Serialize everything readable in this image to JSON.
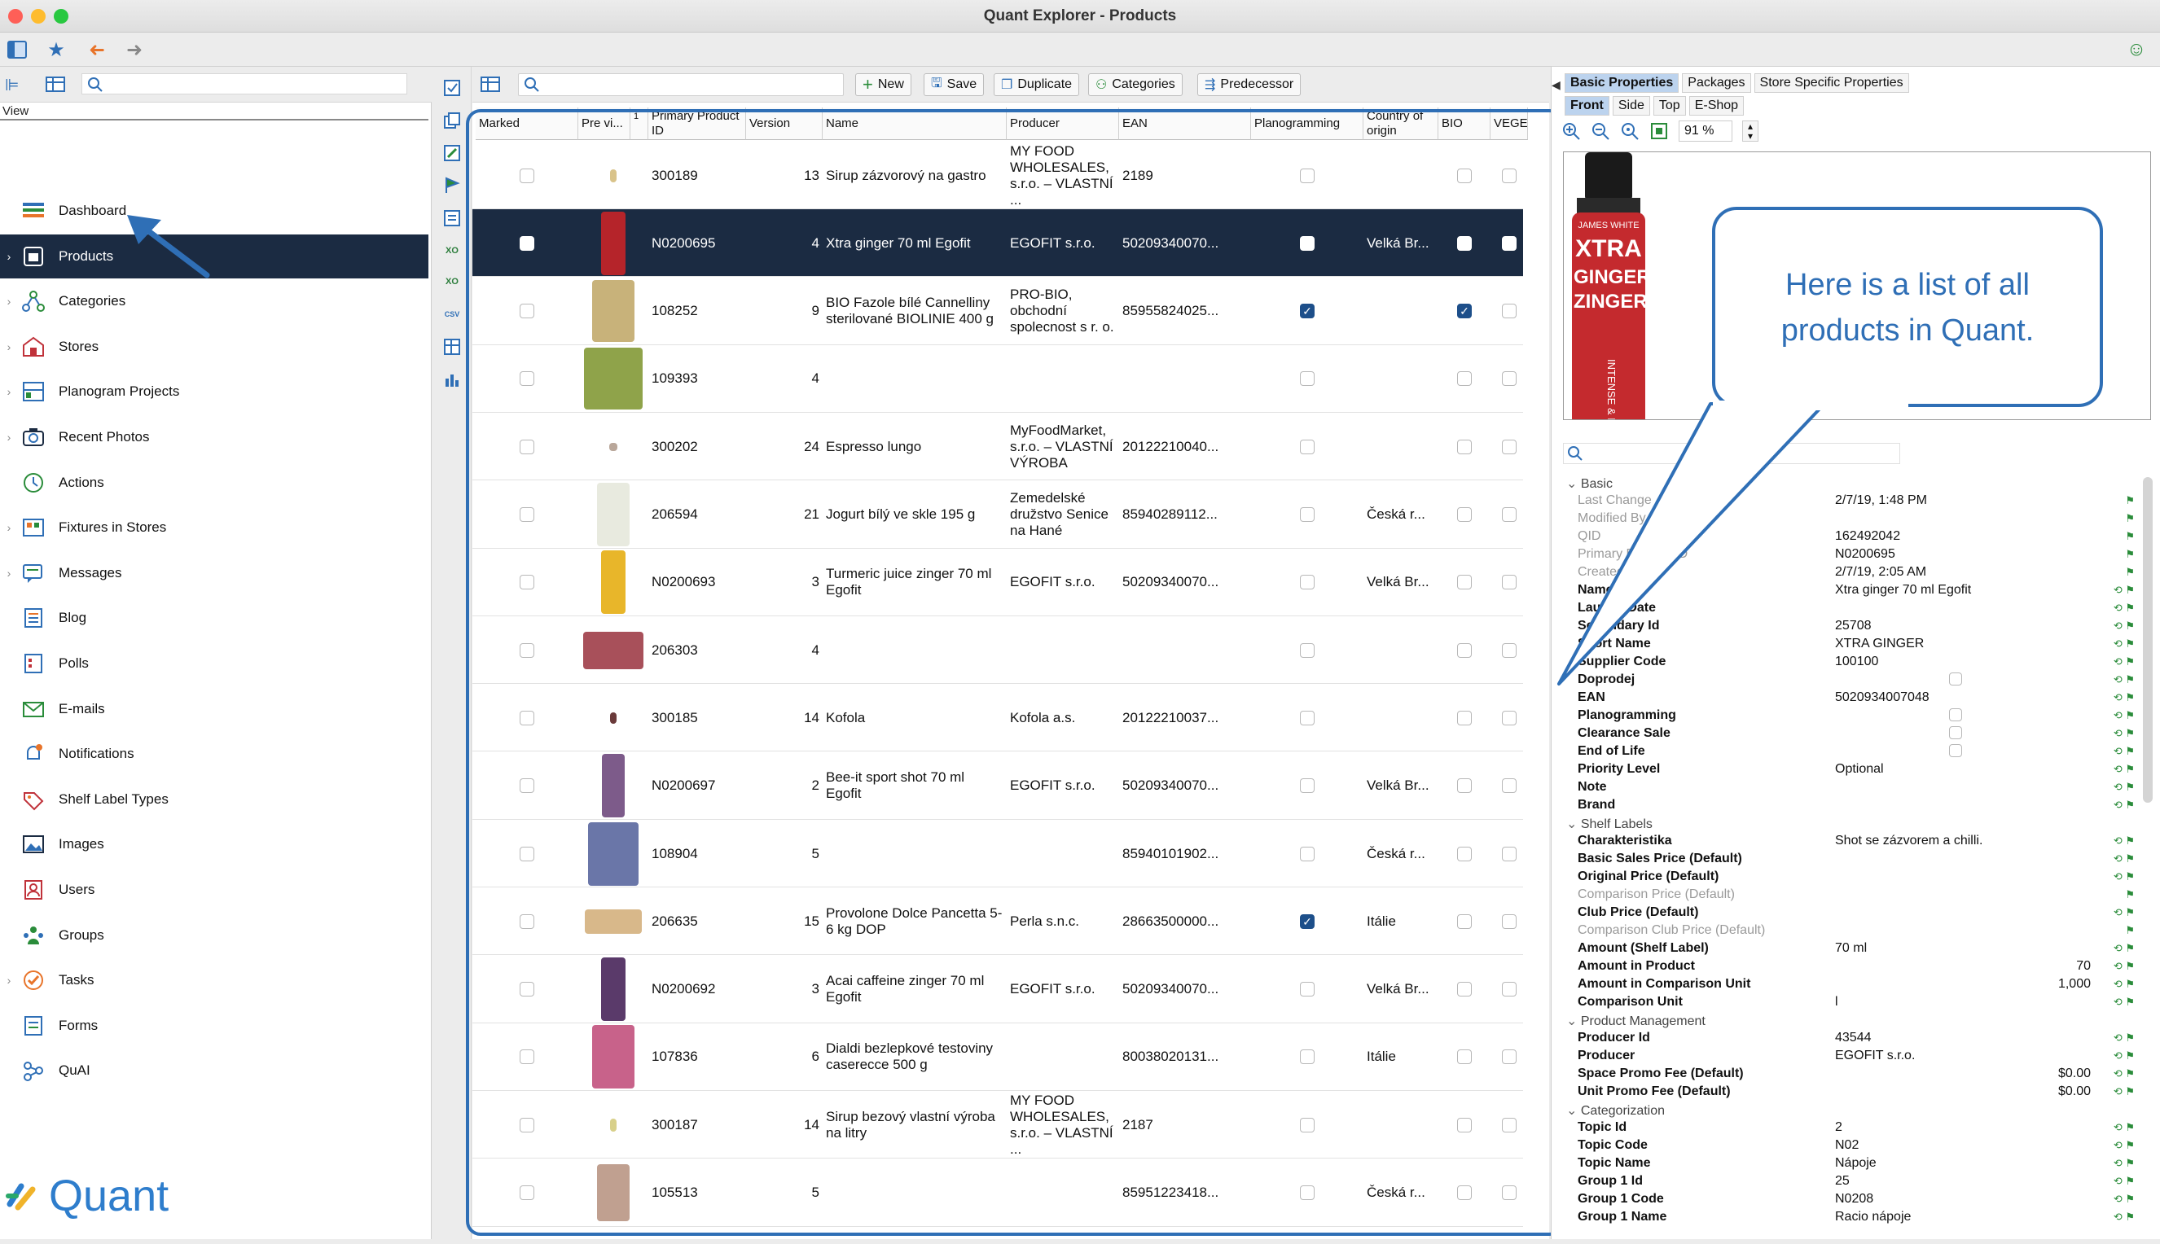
{
  "window": {
    "title": "Quant Explorer - Products"
  },
  "colors": {
    "nav_selected": "#1b2b42",
    "accent": "#2f6fb6",
    "check_on": "#1d4f8a",
    "logo": "#2e7dcc"
  },
  "sidebar": {
    "view_label": "View",
    "items": [
      {
        "label": "Dashboard",
        "icon": "dashboard-icon",
        "chevron": false
      },
      {
        "label": "Products",
        "icon": "products-icon",
        "chevron": true,
        "selected": true
      },
      {
        "label": "Categories",
        "icon": "categories-icon",
        "chevron": true
      },
      {
        "label": "Stores",
        "icon": "stores-icon",
        "chevron": true
      },
      {
        "label": "Planogram Projects",
        "icon": "planogram-icon",
        "chevron": true
      },
      {
        "label": "Recent Photos",
        "icon": "camera-icon",
        "chevron": true
      },
      {
        "label": "Actions",
        "icon": "actions-icon",
        "chevron": false
      },
      {
        "label": "Fixtures in Stores",
        "icon": "fixtures-icon",
        "chevron": true
      },
      {
        "label": "Messages",
        "icon": "messages-icon",
        "chevron": true
      },
      {
        "label": "Blog",
        "icon": "blog-icon",
        "chevron": false
      },
      {
        "label": "Polls",
        "icon": "polls-icon",
        "chevron": false
      },
      {
        "label": "E-mails",
        "icon": "email-icon",
        "chevron": false
      },
      {
        "label": "Notifications",
        "icon": "notifications-icon",
        "chevron": false
      },
      {
        "label": "Shelf Label Types",
        "icon": "shelf-label-icon",
        "chevron": false
      },
      {
        "label": "Images",
        "icon": "images-icon",
        "chevron": false
      },
      {
        "label": "Users",
        "icon": "users-icon",
        "chevron": false
      },
      {
        "label": "Groups",
        "icon": "groups-icon",
        "chevron": false
      },
      {
        "label": "Tasks",
        "icon": "tasks-icon",
        "chevron": true
      },
      {
        "label": "Forms",
        "icon": "forms-icon",
        "chevron": false
      },
      {
        "label": "QuAI",
        "icon": "quai-icon",
        "chevron": false
      }
    ],
    "logo_text": "Quant"
  },
  "toolbar": {
    "new": "New",
    "save": "Save",
    "duplicate": "Duplicate",
    "categories": "Categories",
    "predecessor": "Predecessor"
  },
  "table": {
    "columns": [
      {
        "key": "marked",
        "label": "Marked"
      },
      {
        "key": "preview",
        "label": "Pre vi..."
      },
      {
        "key": "sort_index",
        "label": "1"
      },
      {
        "key": "pid",
        "label": "Primary Product ID"
      },
      {
        "key": "version",
        "label": "Version"
      },
      {
        "key": "name",
        "label": "Name"
      },
      {
        "key": "producer",
        "label": "Producer"
      },
      {
        "key": "ean",
        "label": "EAN"
      },
      {
        "key": "planogramming",
        "label": "Planogramming"
      },
      {
        "key": "country",
        "label": "Country of origin"
      },
      {
        "key": "bio",
        "label": "BIO"
      },
      {
        "key": "vege",
        "label": "VEGE"
      }
    ],
    "rows": [
      {
        "pid": "300189",
        "version": "13",
        "name": "Sirup zázvorový na gastro",
        "producer": "MY FOOD WHOLESALES, s.r.o. – VLASTNÍ ...",
        "ean": "2189",
        "country": "",
        "plano": false,
        "bio": false,
        "thumb": "#d9c38a",
        "thumb_w": 8,
        "thumb_h": 16
      },
      {
        "pid": "N0200695",
        "version": "4",
        "name": "Xtra ginger 70 ml Egofit",
        "producer": "EGOFIT s.r.o.",
        "ean": "50209340070...",
        "country": "Velká Br...",
        "plano": false,
        "bio": false,
        "selected": true,
        "thumb": "#b5242a",
        "thumb_w": 30,
        "thumb_h": 78
      },
      {
        "pid": "108252",
        "version": "9",
        "name": "BIO Fazole bílé Cannelliny sterilované BIOLINIE 400 g",
        "producer": "PRO-BIO, obchodní spolecnost s r. o.",
        "ean": "85955824025...",
        "country": "",
        "plano": true,
        "bio": true,
        "thumb": "#c8b27a",
        "thumb_w": 52,
        "thumb_h": 76
      },
      {
        "pid": "109393",
        "version": "4",
        "name": "",
        "producer": "",
        "ean": "",
        "country": "",
        "plano": false,
        "bio": false,
        "thumb": "#8fa34a",
        "thumb_w": 72,
        "thumb_h": 76
      },
      {
        "pid": "300202",
        "version": "24",
        "name": "Espresso lungo",
        "producer": "MyFoodMarket, s.r.o. – VLASTNÍ VÝROBA",
        "ean": "20122210040...",
        "country": "",
        "plano": false,
        "bio": false,
        "thumb": "#b9a79a",
        "thumb_w": 10,
        "thumb_h": 10
      },
      {
        "pid": "206594",
        "version": "21",
        "name": "Jogurt bílý ve skle 195 g",
        "producer": "Zemedelské družstvo Senice na Hané",
        "ean": "85940289112...",
        "country": "Česká r...",
        "plano": false,
        "bio": false,
        "thumb": "#e8eadf",
        "thumb_w": 40,
        "thumb_h": 78
      },
      {
        "pid": "N0200693",
        "version": "3",
        "name": "Turmeric juice zinger 70 ml Egofit",
        "producer": "EGOFIT s.r.o.",
        "ean": "50209340070...",
        "country": "Velká Br...",
        "plano": false,
        "bio": false,
        "thumb": "#e8b62a",
        "thumb_w": 30,
        "thumb_h": 78
      },
      {
        "pid": "206303",
        "version": "4",
        "name": "",
        "producer": "",
        "ean": "",
        "country": "",
        "plano": false,
        "bio": false,
        "thumb": "#a8505a",
        "thumb_w": 74,
        "thumb_h": 46
      },
      {
        "pid": "300185",
        "version": "14",
        "name": "Kofola",
        "producer": "Kofola a.s.",
        "ean": "20122210037...",
        "country": "",
        "plano": false,
        "bio": false,
        "thumb": "#6a3a3a",
        "thumb_w": 8,
        "thumb_h": 14
      },
      {
        "pid": "N0200697",
        "version": "2",
        "name": "Bee-it sport shot 70 ml Egofit",
        "producer": "EGOFIT s.r.o.",
        "ean": "50209340070...",
        "country": "Velká Br...",
        "plano": false,
        "bio": false,
        "thumb": "#7d5b8a",
        "thumb_w": 28,
        "thumb_h": 78
      },
      {
        "pid": "108904",
        "version": "5",
        "name": "",
        "producer": "",
        "ean": "85940101902...",
        "country": "Česká r...",
        "plano": false,
        "bio": false,
        "thumb": "#6a76a8",
        "thumb_w": 62,
        "thumb_h": 78
      },
      {
        "pid": "206635",
        "version": "15",
        "name": "Provolone Dolce Pancetta 5-6 kg DOP",
        "producer": "Perla s.n.c.",
        "ean": "28663500000...",
        "country": "Itálie",
        "plano": true,
        "bio": false,
        "thumb": "#d8b88a",
        "thumb_w": 70,
        "thumb_h": 30
      },
      {
        "pid": "N0200692",
        "version": "3",
        "name": "Acai caffeine zinger 70 ml Egofit",
        "producer": "EGOFIT s.r.o.",
        "ean": "50209340070...",
        "country": "Velká Br...",
        "plano": false,
        "bio": false,
        "thumb": "#5a3a6a",
        "thumb_w": 30,
        "thumb_h": 78
      },
      {
        "pid": "107836",
        "version": "6",
        "name": "Dialdi bezlepkové testoviny caserecce 500 g",
        "producer": "",
        "ean": "80038020131...",
        "country": "Itálie",
        "plano": false,
        "bio": false,
        "thumb": "#c8628a",
        "thumb_w": 52,
        "thumb_h": 78
      },
      {
        "pid": "300187",
        "version": "14",
        "name": "Sirup bezový vlastní výroba na litry",
        "producer": "MY FOOD WHOLESALES, s.r.o. – VLASTNÍ ...",
        "ean": "2187",
        "country": "",
        "plano": false,
        "bio": false,
        "thumb": "#d8d08a",
        "thumb_w": 8,
        "thumb_h": 16
      },
      {
        "pid": "105513",
        "version": "5",
        "name": "",
        "producer": "",
        "ean": "85951223418...",
        "country": "Česká r...",
        "plano": false,
        "bio": false,
        "thumb": "#c0a090",
        "thumb_w": 40,
        "thumb_h": 70
      }
    ]
  },
  "right": {
    "tabs_top": [
      "Basic Properties",
      "Packages",
      "Store Specific Properties"
    ],
    "tabs_view": [
      "Front",
      "Side",
      "Top",
      "E-Shop"
    ],
    "zoom": "91 %",
    "preview_text": {
      "brand": "JAMES WHITE",
      "line1": "XTRA",
      "line2": "GINGER",
      "line3": "ZINGER",
      "side": "INTENSE & FIERY"
    },
    "properties": [
      {
        "t": "sec",
        "k": "Basic"
      },
      {
        "t": "dim",
        "k": "Last Change",
        "v": "2/7/19, 1:48 PM"
      },
      {
        "t": "dim",
        "k": "Modified By",
        "v": ""
      },
      {
        "t": "dim",
        "k": "QID",
        "v": "162492042"
      },
      {
        "t": "dim",
        "k": "Primary Product ID",
        "v": "N0200695"
      },
      {
        "t": "dim",
        "k": "Created",
        "v": "2/7/19, 2:05 AM"
      },
      {
        "t": "b",
        "k": "Name",
        "v": "Xtra ginger 70 ml Egofit"
      },
      {
        "t": "b",
        "k": "Launch Date",
        "v": ""
      },
      {
        "t": "b",
        "k": "Secondary Id",
        "v": "25708"
      },
      {
        "t": "b",
        "k": "Short Name",
        "v": "XTRA GINGER"
      },
      {
        "t": "b",
        "k": "Supplier Code",
        "v": "100100"
      },
      {
        "t": "b",
        "k": "Doprodej",
        "v": "",
        "cb": true
      },
      {
        "t": "b",
        "k": "EAN",
        "v": "5020934007048"
      },
      {
        "t": "b",
        "k": "Planogramming",
        "v": "",
        "cb": true
      },
      {
        "t": "b",
        "k": "Clearance Sale",
        "v": "",
        "cb": true
      },
      {
        "t": "b",
        "k": "End of Life",
        "v": "",
        "cb": true
      },
      {
        "t": "b",
        "k": "Priority Level",
        "v": "Optional"
      },
      {
        "t": "b",
        "k": "Note",
        "v": ""
      },
      {
        "t": "b",
        "k": "Brand",
        "v": ""
      },
      {
        "t": "sec",
        "k": "Shelf Labels"
      },
      {
        "t": "b",
        "k": "Charakteristika",
        "v": "Shot se zázvorem a chilli."
      },
      {
        "t": "b",
        "k": "Basic Sales Price (Default)",
        "v": ""
      },
      {
        "t": "b",
        "k": "Original Price (Default)",
        "v": ""
      },
      {
        "t": "dim",
        "k": "Comparison Price (Default)",
        "v": ""
      },
      {
        "t": "b",
        "k": "Club Price (Default)",
        "v": ""
      },
      {
        "t": "dim",
        "k": "Comparison Club Price (Default)",
        "v": ""
      },
      {
        "t": "b",
        "k": "Amount (Shelf Label)",
        "v": "70 ml"
      },
      {
        "t": "b",
        "k": "Amount in Product",
        "vr": "70"
      },
      {
        "t": "b",
        "k": "Amount in Comparison Unit",
        "vr": "1,000"
      },
      {
        "t": "b",
        "k": "Comparison Unit",
        "v": "l"
      },
      {
        "t": "sec",
        "k": "Product Management"
      },
      {
        "t": "b",
        "k": "Producer Id",
        "v": "43544"
      },
      {
        "t": "b",
        "k": "Producer",
        "v": "EGOFIT s.r.o."
      },
      {
        "t": "b",
        "k": "Space Promo Fee (Default)",
        "vr": "$0.00"
      },
      {
        "t": "b",
        "k": "Unit Promo Fee (Default)",
        "vr": "$0.00"
      },
      {
        "t": "sec",
        "k": "Categorization"
      },
      {
        "t": "b",
        "k": "Topic Id",
        "v": "2"
      },
      {
        "t": "b",
        "k": "Topic Code",
        "v": "N02"
      },
      {
        "t": "b",
        "k": "Topic Name",
        "v": "Nápoje"
      },
      {
        "t": "b",
        "k": "Group 1 Id",
        "v": "25"
      },
      {
        "t": "b",
        "k": "Group 1 Code",
        "v": "N0208"
      },
      {
        "t": "b",
        "k": "Group 1 Name",
        "v": "Racio nápoje"
      }
    ]
  },
  "callout": {
    "text": "Here is a list of all products in Quant."
  }
}
